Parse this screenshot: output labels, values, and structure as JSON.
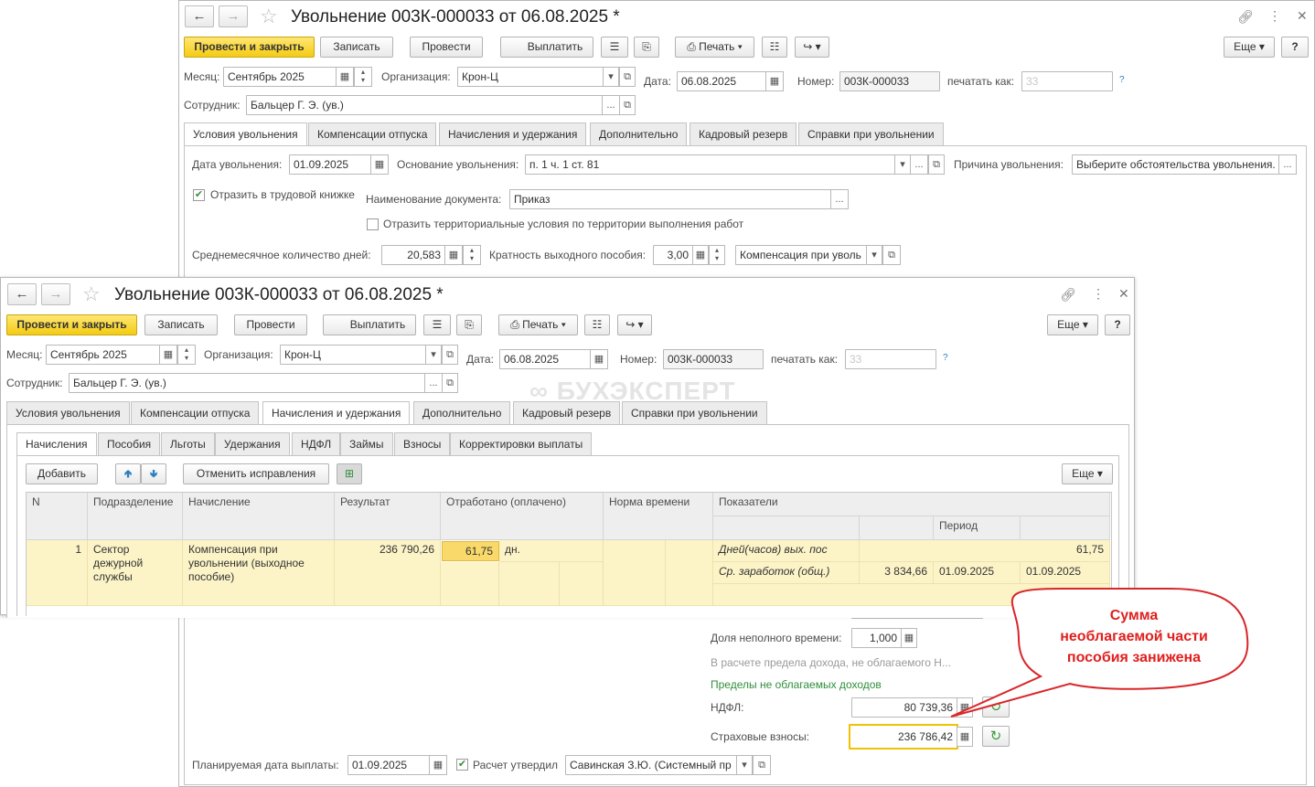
{
  "doc_title": "Увольнение 003К-000033 от 06.08.2025 *",
  "toolbar": {
    "post_close": "Провести и закрыть",
    "save": "Записать",
    "post": "Провести",
    "pay": "Выплатить",
    "print": "Печать",
    "more": "Еще",
    "help": "?"
  },
  "header": {
    "month_label": "Месяц:",
    "month_value": "Сентябрь 2025",
    "org_label": "Организация:",
    "org_value": "Крон-Ц",
    "date_label": "Дата:",
    "date_value": "06.08.2025",
    "number_label": "Номер:",
    "number_value": "003К-000033",
    "print_as_label": "печатать как:",
    "print_as_value": "33",
    "help_mark": "?",
    "employee_label": "Сотрудник:",
    "employee_value": "Бальцер Г. Э. (ув.)"
  },
  "tabs": [
    "Условия увольнения",
    "Компенсации отпуска",
    "Начисления и удержания",
    "Дополнительно",
    "Кадровый резерв",
    "Справки при увольнении"
  ],
  "conditions": {
    "dismissal_date_label": "Дата увольнения:",
    "dismissal_date": "01.09.2025",
    "basis_label": "Основание увольнения:",
    "basis_value": "п. 1 ч. 1 ст. 81",
    "reason_label": "Причина увольнения:",
    "reason_value": "Выберите обстоятельства увольнения.",
    "reflect_book": "Отразить в трудовой книжке",
    "doc_name_label": "Наименование документа:",
    "doc_name_value": "Приказ",
    "territorial": "Отразить территориальные условия по территории выполнения работ",
    "avg_days_label": "Среднемесячное количество дней:",
    "avg_days_value": "20,583",
    "multiplicity_label": "Кратность выходного пособия:",
    "multiplicity_value": "3,00",
    "compensation_value": "Компенсация при уволь"
  },
  "subtabs": [
    "Начисления",
    "Пособия",
    "Льготы",
    "Удержания",
    "НДФЛ",
    "Займы",
    "Взносы",
    "Корректировки выплаты"
  ],
  "accruals_toolbar": {
    "add": "Добавить",
    "cancel_fix": "Отменить исправления",
    "more": "Еще"
  },
  "grid": {
    "headers": {
      "n": "N",
      "dept": "Подразделение",
      "accrual": "Начисление",
      "result": "Результат",
      "worked": "Отработано (оплачено)",
      "norm": "Норма времени",
      "indicators": "Показатели",
      "period": "Период"
    },
    "row": {
      "n": "1",
      "dept": "Сектор дежурной службы",
      "accrual": "Компенсация при увольнении (выходное пособие)",
      "result": "236 790,26",
      "worked": "61,75",
      "worked_unit": "дн.",
      "ind1_name": "Дней(часов) вых. пос",
      "ind1_value": "61,75",
      "ind2_name": "Ср. заработок (общ.)",
      "ind2_value": "3 834,66",
      "ind2_period1": "01.09.2025",
      "ind2_period2": "01.09.2025"
    }
  },
  "lower": {
    "part_time_label": "Доля неполного времени:",
    "part_time_value": "1,000",
    "limit_note": "В расчете предела дохода, не облагаемого Н...",
    "limits_link": "Пределы не облагаемых доходов",
    "ndfl_label": "НДФЛ:",
    "ndfl_value": "80 739,36",
    "insurance_label": "Страховые взносы:",
    "insurance_value": "236 786,42",
    "planned_date_label": "Планируемая дата выплаты:",
    "planned_date_value": "01.09.2025",
    "calc_approved": "Расчет утвердил",
    "approver_value": "Савинская З.Ю. (Системный пр"
  },
  "watermark": "БУХЭКСПЕРТ",
  "callout": {
    "line1": "Сумма",
    "line2": "необлагаемой части",
    "line3": "пособия занижена"
  },
  "colors": {
    "primary_button": "#f4cb12",
    "selected_row": "#fcf4c7",
    "callout_text": "#e0201e",
    "callout_border": "#d9262a",
    "link_green": "#2f8f3a"
  }
}
